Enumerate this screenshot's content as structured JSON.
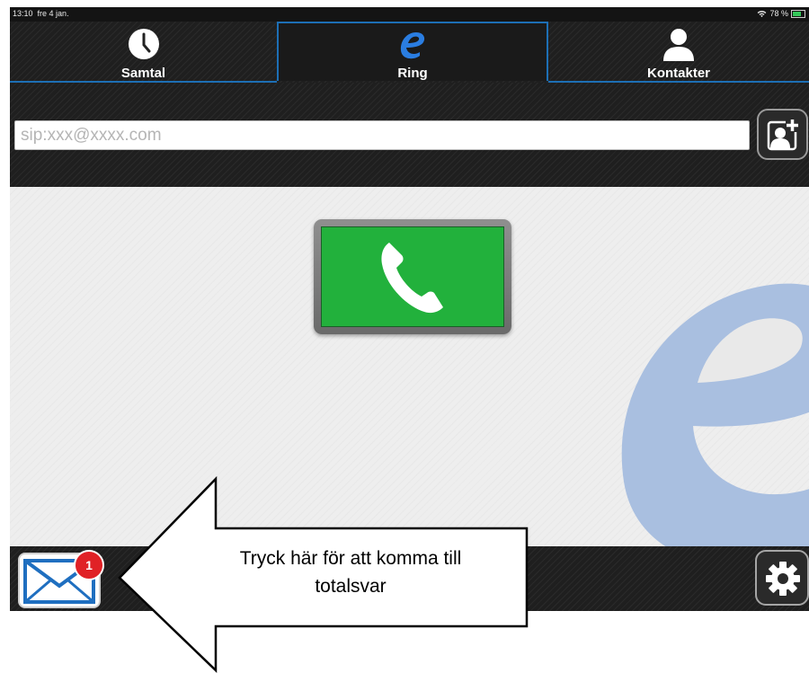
{
  "status_bar": {
    "time": "13:10",
    "date": "fre 4 jan.",
    "battery": "78 %",
    "wifi_icon": "wifi-icon",
    "battery_icon": "battery-icon"
  },
  "tabs": [
    {
      "label": "Samtal",
      "icon": "clock-icon"
    },
    {
      "label": "Ring",
      "icon": "e-logo-icon",
      "selected": true
    },
    {
      "label": "Kontakter",
      "icon": "person-icon"
    }
  ],
  "address": {
    "placeholder": "sip:xxx@xxxx.com",
    "value": ""
  },
  "add_contact": {
    "icon": "add-contact-icon"
  },
  "call": {
    "icon": "phone-icon",
    "color": "#22b13c"
  },
  "messages": {
    "icon": "mail-icon",
    "badge_count": "1"
  },
  "settings": {
    "icon": "gear-icon"
  },
  "callout": {
    "line1": "Tryck här för att komma till",
    "line2": "totalsvar"
  },
  "colors": {
    "accent": "#1d6fb5",
    "call_green": "#22b13c",
    "badge_red": "#e02126"
  }
}
